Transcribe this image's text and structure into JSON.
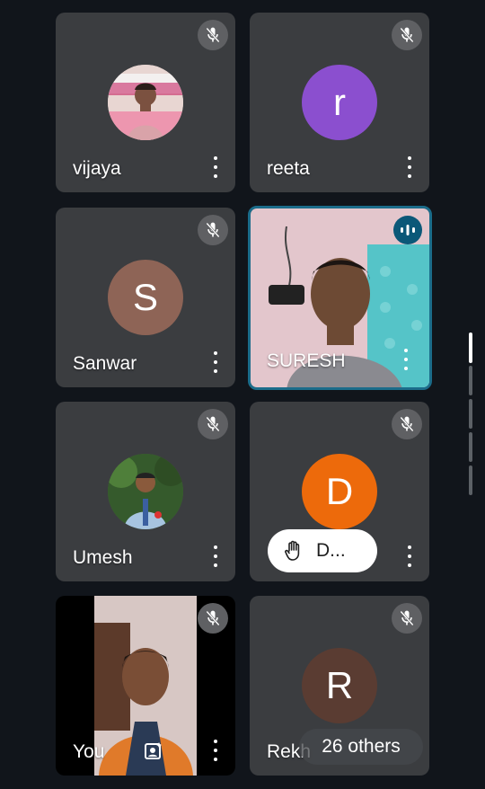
{
  "participants": [
    {
      "name": "vijaya",
      "avatar_type": "photo",
      "muted": true
    },
    {
      "name": "reeta",
      "avatar_letter": "r",
      "avatar_color": "#8b4fcf",
      "muted": true
    },
    {
      "name": "Sanwar",
      "avatar_letter": "S",
      "avatar_color": "#8e6456",
      "muted": true
    },
    {
      "name": "SURESH",
      "avatar_type": "video",
      "speaking": true
    },
    {
      "name": "Umesh",
      "avatar_type": "photo",
      "muted": true
    },
    {
      "name": "D...",
      "avatar_letter": "D",
      "avatar_color": "#ed6a0b",
      "muted": true,
      "hand_raised": true
    },
    {
      "name": "You",
      "avatar_type": "video",
      "muted": true
    },
    {
      "name": "Rekh",
      "avatar_letter": "R",
      "avatar_color": "#5a3c32",
      "muted": true
    }
  ],
  "others_label": "26 others",
  "icons": {
    "mute": "mic-off-icon",
    "speaking": "audio-wave-icon",
    "more": "more-vert-icon",
    "hand": "raised-hand-icon",
    "effects": "portrait-effect-icon"
  }
}
